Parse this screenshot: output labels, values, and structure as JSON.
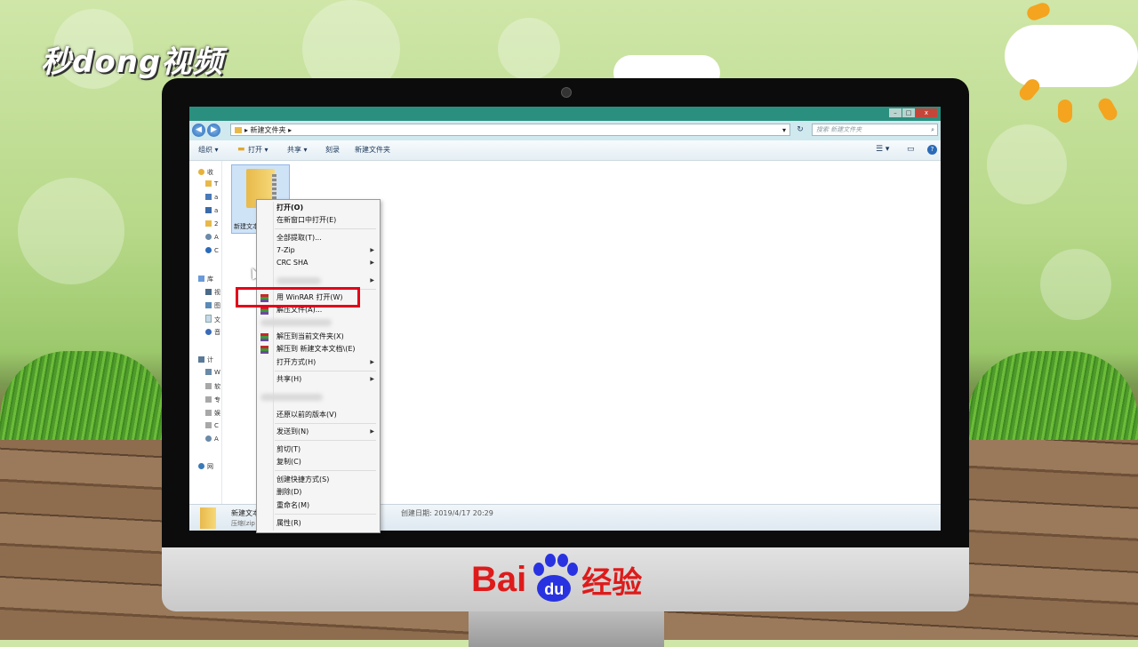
{
  "watermark": {
    "logo_text": "秒dong视频"
  },
  "monitor_brand": {
    "text_left": "Bai",
    "text_paw": "du",
    "text_right": "经验"
  },
  "window": {
    "buttons": {
      "minimize": "–",
      "maximize": "□",
      "close": "x"
    },
    "address": {
      "path": "▸ 新建文件夹 ▸",
      "dropdown": "▾"
    },
    "refresh_symbol": "↻",
    "search": {
      "placeholder": "搜索 新建文件夹"
    }
  },
  "toolbar": {
    "organize": "组织 ▾",
    "open": "打开 ▾",
    "share": "共享 ▾",
    "burn": "刻录",
    "new_folder": "新建文件夹",
    "help": "?"
  },
  "navpane": {
    "items": [
      {
        "label": "收",
        "icon": "star-icon"
      },
      {
        "label": "T",
        "icon": "folder-icon"
      },
      {
        "label": "a",
        "icon": "desktop-icon"
      },
      {
        "label": "a",
        "icon": "downloads-icon"
      },
      {
        "label": "2",
        "icon": "folder-icon"
      },
      {
        "label": "A",
        "icon": "network-icon"
      },
      {
        "label": "C",
        "icon": "cloud-icon"
      },
      {
        "label": "库",
        "icon": "library-icon"
      },
      {
        "label": "视",
        "icon": "video-icon"
      },
      {
        "label": "图",
        "icon": "picture-icon"
      },
      {
        "label": "文",
        "icon": "document-icon"
      },
      {
        "label": "音",
        "icon": "music-icon"
      },
      {
        "label": "计",
        "icon": "computer-icon"
      },
      {
        "label": "W",
        "icon": "drive-icon"
      },
      {
        "label": "软",
        "icon": "drive-icon"
      },
      {
        "label": "专",
        "icon": "drive-icon"
      },
      {
        "label": "娱",
        "icon": "drive-icon"
      },
      {
        "label": "C",
        "icon": "drive-icon"
      },
      {
        "label": "A",
        "icon": "network-icon"
      },
      {
        "label": "网",
        "icon": "network-icon"
      }
    ]
  },
  "content": {
    "file_label": "新建文本"
  },
  "statusbar": {
    "name": "新建文本",
    "type": "压缩(zip",
    "date": "创建日期: 2019/4/17 20:29"
  },
  "context_menu": {
    "open": "打开(O)",
    "open_new_window": "在新窗口中打开(E)",
    "extract_all": "全部提取(T)...",
    "seven_zip": "7-Zip",
    "crc_sha": "CRC SHA",
    "winrar_open": "用 WinRAR 打开(W)",
    "extract_files": "解压文件(A)...",
    "extract_here": "解压到当前文件夹(X)",
    "extract_to": "解压到 新建文本文档\\(E)",
    "open_with": "打开方式(H)",
    "share": "共享(H)",
    "restore": "还原以前的版本(V)",
    "send_to": "发送到(N)",
    "cut": "剪切(T)",
    "copy": "复制(C)",
    "shortcut": "创建快捷方式(S)",
    "delete": "删除(D)",
    "rename": "重命名(M)",
    "properties": "属性(R)",
    "submenu_arrow": "▶"
  }
}
